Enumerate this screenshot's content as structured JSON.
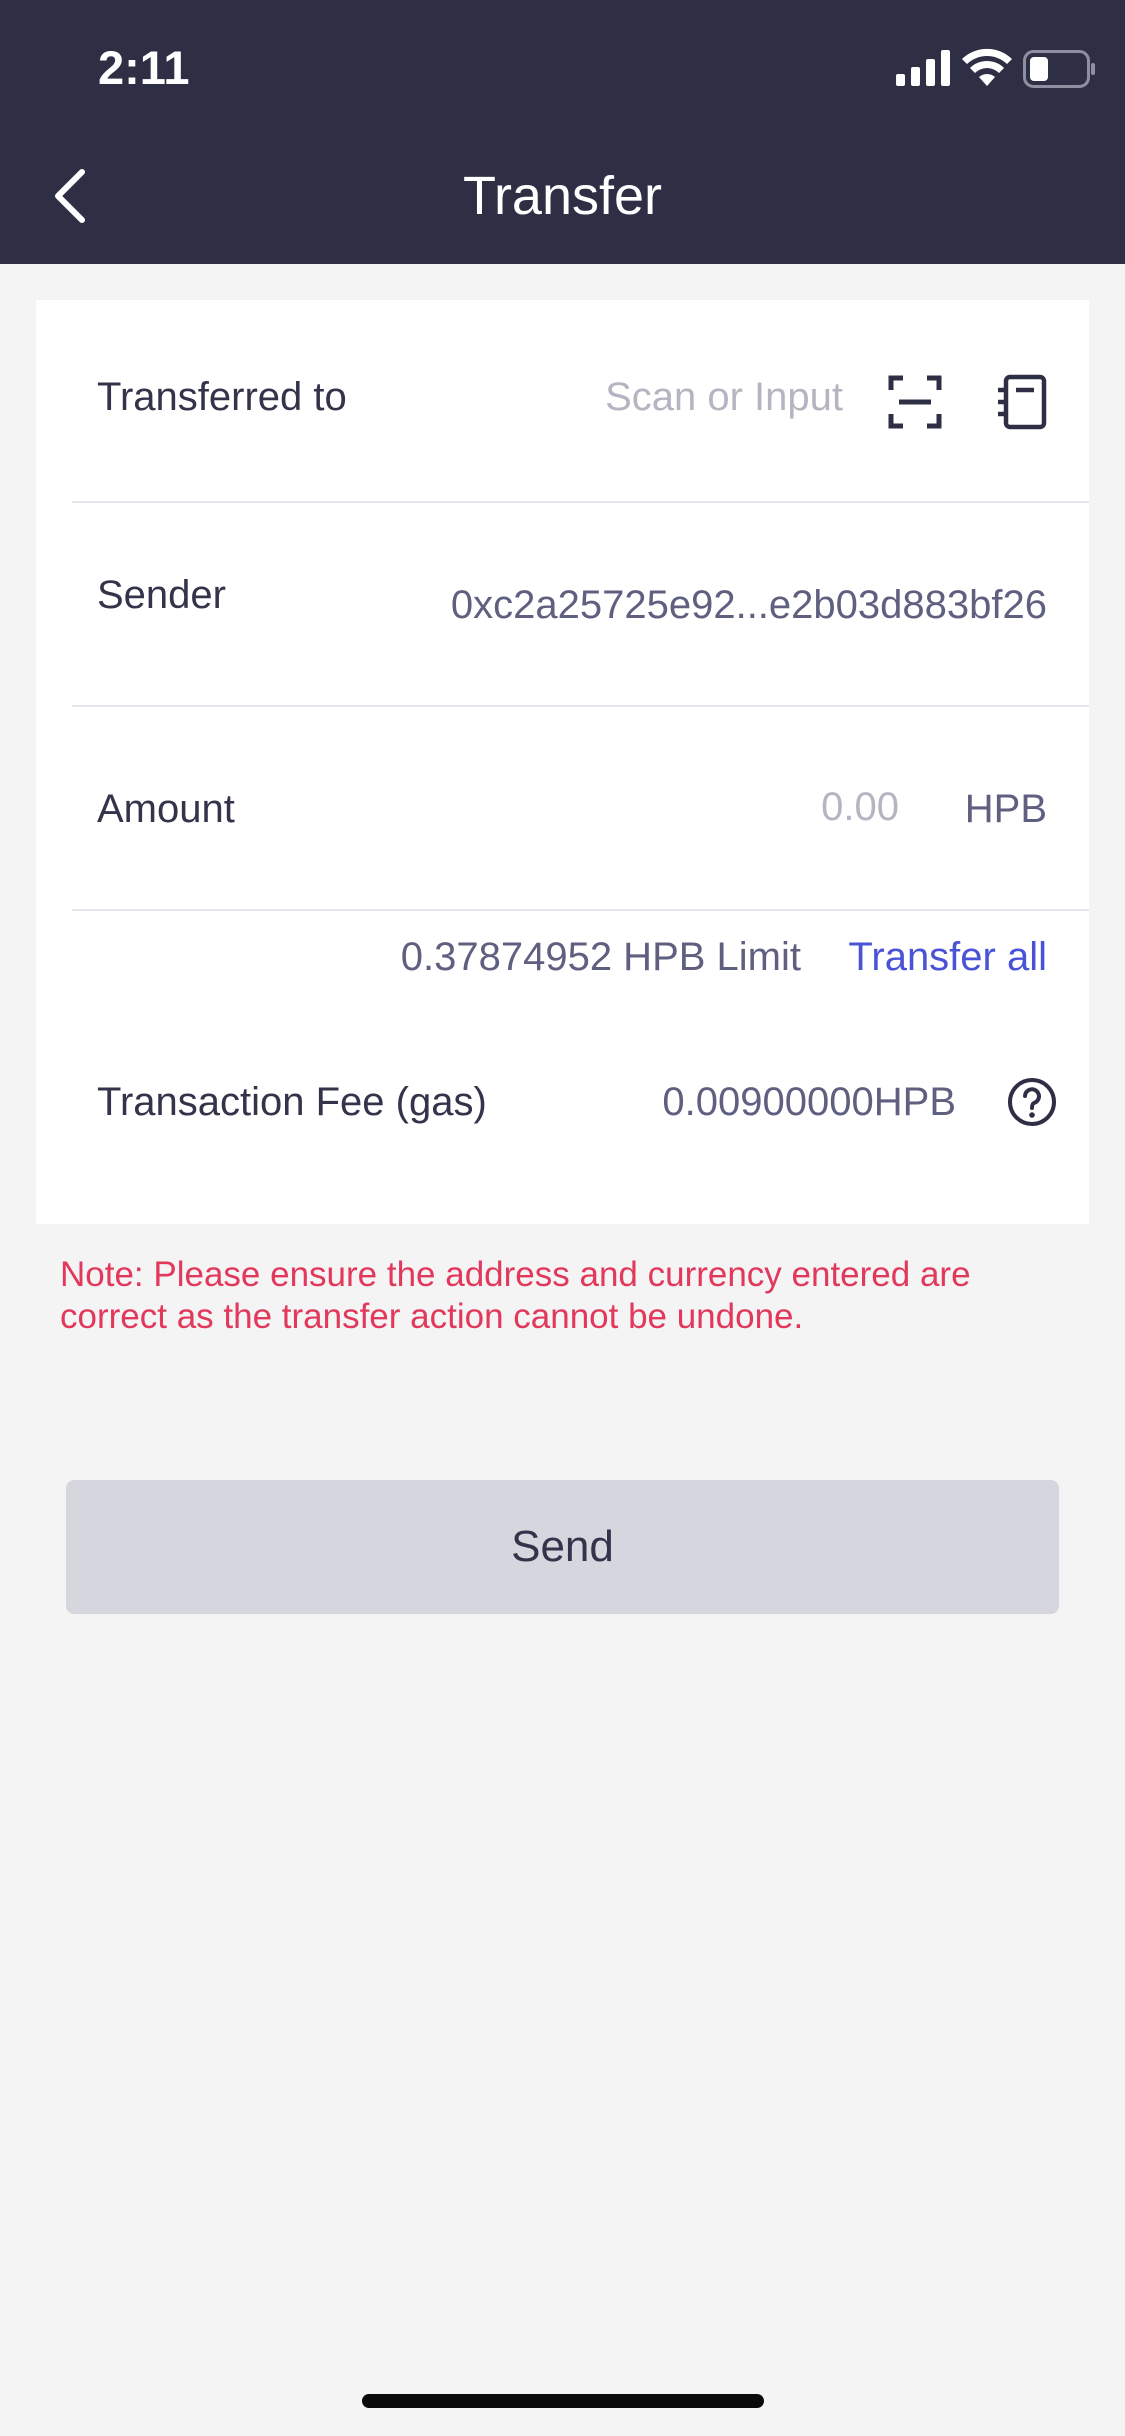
{
  "status_bar": {
    "time": "2:11"
  },
  "header": {
    "title": "Transfer"
  },
  "form": {
    "to_label": "Transferred to",
    "to_placeholder": "Scan or Input",
    "sender_label": "Sender",
    "sender_value": "0xc2a25725e92...e2b03d883bf26",
    "amount_label": "Amount",
    "amount_placeholder": "0.00",
    "amount_unit": "HPB",
    "limit_text": "0.37874952 HPB Limit",
    "transfer_all": "Transfer all",
    "fee_label": "Transaction Fee (gas)",
    "fee_value": "0.00900000HPB"
  },
  "note": "Note: Please ensure the address and currency entered are correct as the transfer action cannot be undone.",
  "send_label": "Send",
  "icons": {
    "back": "back-chevron-icon",
    "scan": "scan-icon",
    "address_book": "address-book-icon",
    "help": "question-circle-icon"
  },
  "colors": {
    "header_bg": "#2e2f45",
    "accent_link": "#4a53d6",
    "warning": "#e2385b",
    "button_bg": "#d6d6de"
  }
}
